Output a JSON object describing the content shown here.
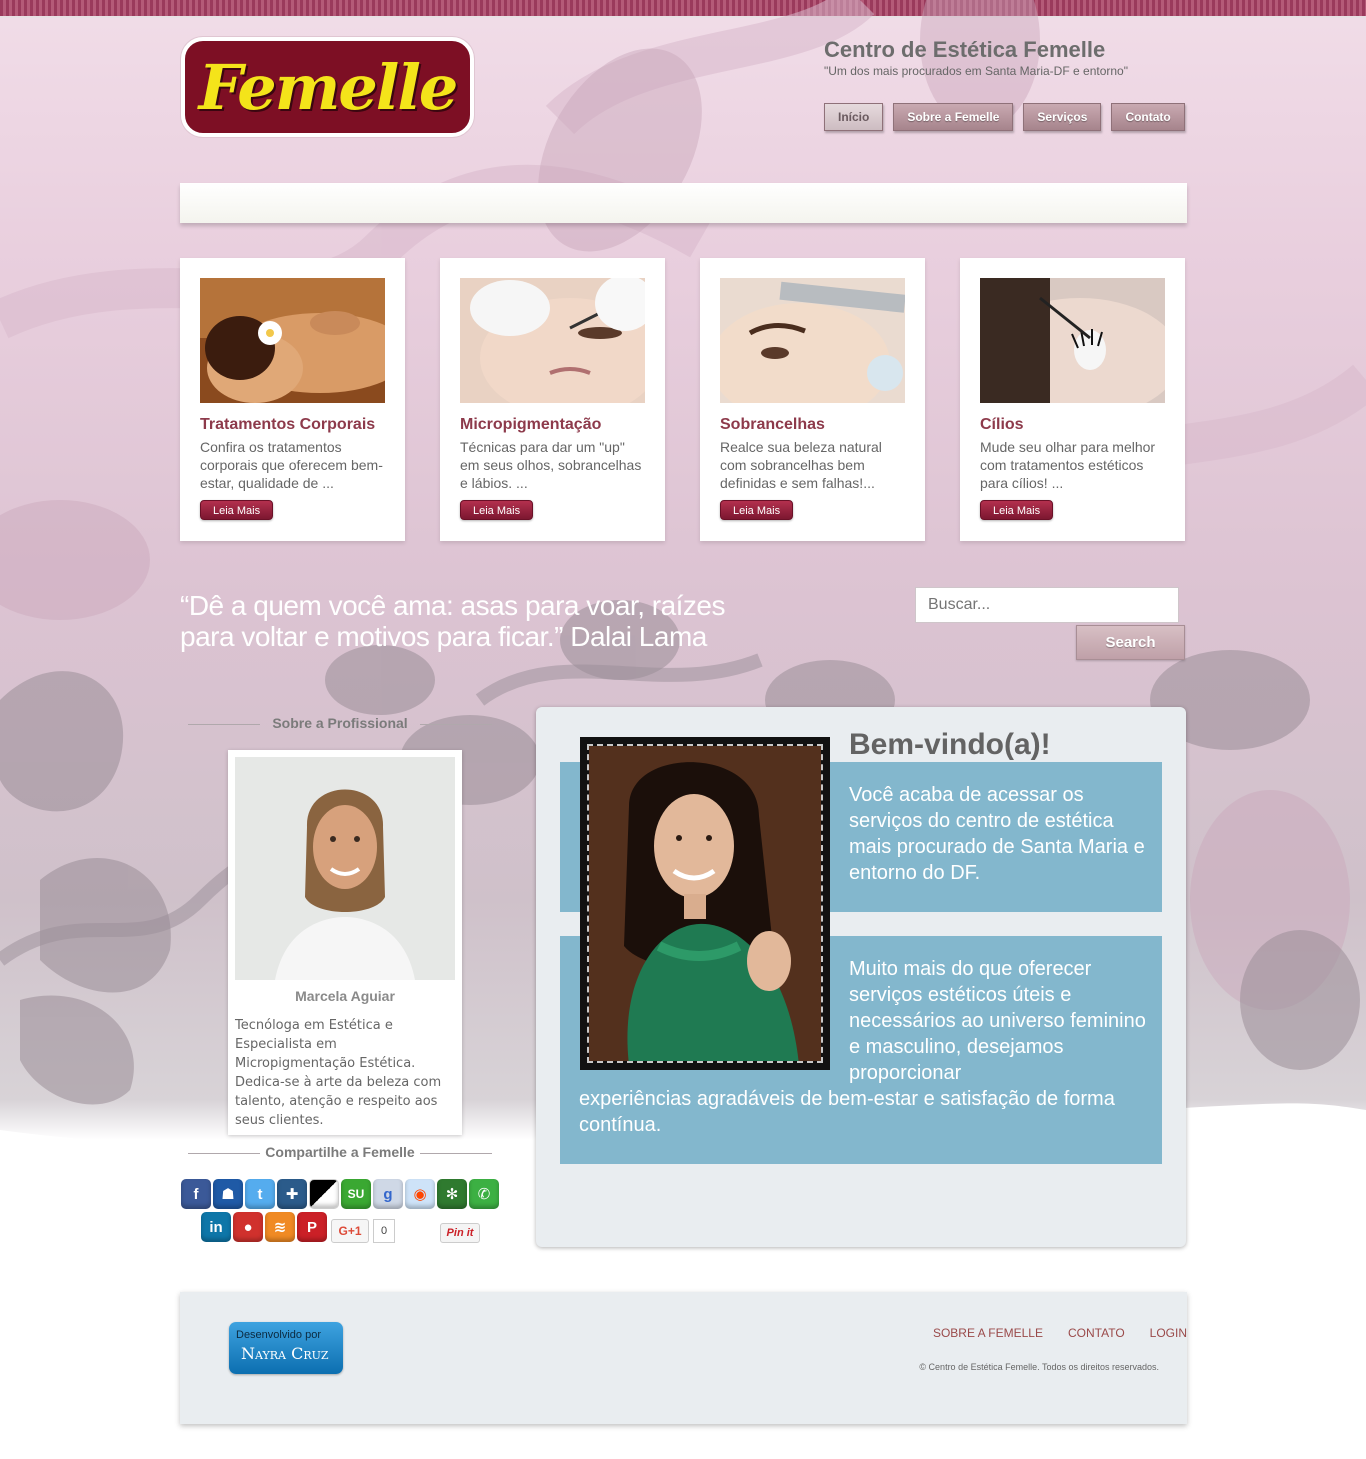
{
  "site": {
    "logo_text": "Femelle",
    "title": "Centro de Estética Femelle",
    "tagline": "\"Um dos mais procurados em Santa Maria-DF e entorno\""
  },
  "nav": [
    {
      "label": "Início",
      "active": true
    },
    {
      "label": "Sobre a Femelle",
      "active": false
    },
    {
      "label": "Serviços",
      "active": false
    },
    {
      "label": "Contato",
      "active": false
    }
  ],
  "cards": [
    {
      "title": "Tratamentos Corporais",
      "text": "Confira os tratamentos corporais que oferecem bem-estar, qualidade de ...",
      "button": "Leia Mais",
      "image": "massage-photo"
    },
    {
      "title": "Micropigmentação",
      "text": "Técnicas para dar um \"up\" em seus olhos, sobrancelhas e lábios. ...",
      "button": "Leia Mais",
      "image": "micropigmentation-photo"
    },
    {
      "title": "Sobrancelhas",
      "text": "Realce sua beleza natural com sobrancelhas bem definidas e sem falhas!...",
      "button": "Leia Mais",
      "image": "eyebrow-photo"
    },
    {
      "title": "Cílios",
      "text": "Mude seu olhar para melhor com tratamentos estéticos para cílios! ...",
      "button": "Leia Mais",
      "image": "eyelash-photo"
    }
  ],
  "quote": {
    "line1": "“Dê a quem você ama: asas para voar, raízes",
    "line2": "para voltar e motivos para ficar.” Dalai Lama"
  },
  "search": {
    "placeholder": "Buscar...",
    "button": "Search"
  },
  "sidebar": {
    "heading": "Sobre a Profissional",
    "name": "Marcela Aguiar",
    "bio": "Tecnóloga em Estética e Especialista em Micropigmentação Estética. Dedica-se à arte da beleza com talento, atenção e respeito aos seus clientes.",
    "share_heading": "Compartilhe a Femelle",
    "share_icons": [
      "facebook-icon",
      "myspace-icon",
      "twitter-icon",
      "digg-icon",
      "delicious-icon",
      "stumbleupon-icon",
      "google-bookmarks-icon",
      "reddit-icon",
      "evernote-icon",
      "whatsapp-icon",
      "linkedin-icon",
      "pinterest-alt-icon",
      "rss-icon",
      "pinterest-icon"
    ],
    "gplus_label": "G+1",
    "gplus_count": "0",
    "pinit_label": "Pin it"
  },
  "welcome": {
    "title": "Bem-vindo(a)!",
    "p1": "Você acaba de acessar os serviços do centro de estética mais procurado de Santa Maria e entorno do DF.",
    "p2a": "Muito mais do que oferecer serviços estéticos úteis e necessários ao universo feminino e masculino, desejamos proporcionar",
    "p2b": "experiências agradáveis de bem-estar e satisfação de forma contínua."
  },
  "footer": {
    "dev_label": "Desenvolvido por",
    "dev_name": "Nayra Cruz",
    "links": [
      "SOBRE A FEMELLE",
      "CONTATO",
      "LOGIN"
    ],
    "copyright": "© Centro de Estética Femelle. Todos os direitos reservados."
  },
  "colors": {
    "brand": "#7d0f24",
    "accent_text": "#8d3a4b",
    "welcome_blue": "#83b7cd"
  }
}
